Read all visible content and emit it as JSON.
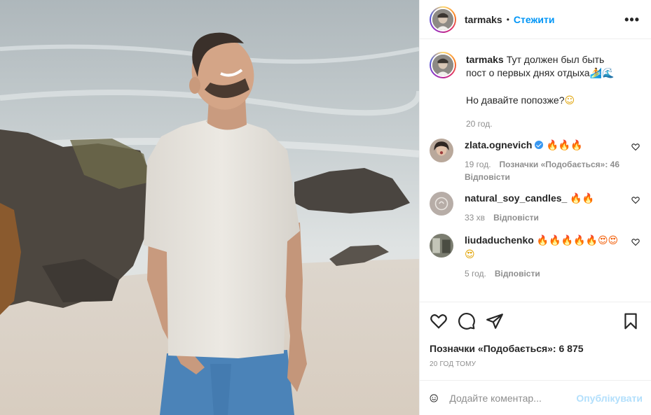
{
  "post": {
    "photo_alt": "",
    "author": "tarmaks",
    "follow_label": "Стежити",
    "more_label": "•••"
  },
  "caption": {
    "user": "tarmaks",
    "line1": "Тут должен был быть пост о первых днях отдыха",
    "line1_emoji": "🏄🌊",
    "line2": "Но давайте попозже?",
    "line2_emoji": "☺",
    "time": "20 год."
  },
  "comments": [
    {
      "user": "zlata.ognevich",
      "verified": true,
      "text": "🔥🔥🔥",
      "time": "19 год.",
      "likes": "Позначки «Подобається»: 46",
      "reply": "Відповісти"
    },
    {
      "user": "natural_soy_candles_",
      "verified": false,
      "text": "🔥🔥",
      "time": "33 хв",
      "reply": "Відповісти"
    },
    {
      "user": "liudaduchenko",
      "verified": false,
      "text": "🔥🔥🔥🔥🔥😍😍",
      "text2": "😍",
      "time": "5 год.",
      "reply": "Відповісти"
    }
  ],
  "actions": {
    "likes_text": "Позначки «Подобається»: 6 875",
    "posted_ago": "20 ГОД ТОМУ"
  },
  "composer": {
    "placeholder": "Додайте коментар...",
    "post_label": "Опублікувати"
  },
  "colors": {
    "accent": "#0095f6",
    "post_disabled": "#b2dffc",
    "meta": "#8e8e8e"
  }
}
